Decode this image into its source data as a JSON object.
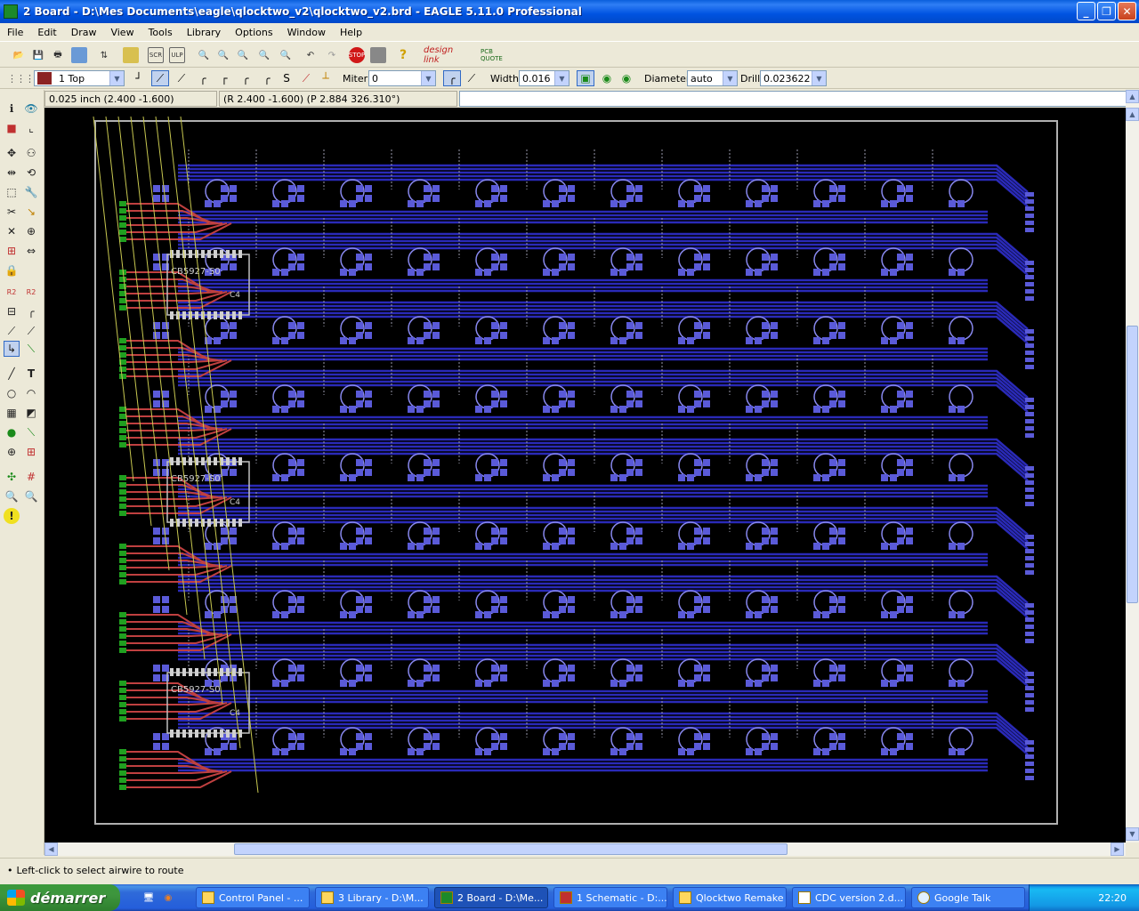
{
  "window": {
    "title": "2 Board - D:\\Mes Documents\\eagle\\qlocktwo_v2\\qlocktwo_v2.brd - EAGLE 5.11.0 Professional",
    "buttons": [
      "minimize-icon",
      "maximize-icon",
      "close-icon"
    ]
  },
  "menu": [
    "File",
    "Edit",
    "Draw",
    "View",
    "Tools",
    "Library",
    "Options",
    "Window",
    "Help"
  ],
  "toolbar1": {
    "icons": [
      "open-icon",
      "save-icon",
      "print-icon",
      "cam-icon",
      "board-icon",
      "library-icon",
      "script-icon",
      "ulp-icon",
      "zoom-fit-icon",
      "zoom-in-icon",
      "zoom-out-icon",
      "zoom-redraw-icon",
      "zoom-select-icon",
      "undo-icon",
      "redo-icon",
      "stop-icon",
      "go-icon",
      "help-icon",
      "design-link-icon",
      "pcb-quote-icon"
    ],
    "stop_label": "STOP",
    "design_link_label": "design link",
    "pcb_quote_label": "PCB QUOTE"
  },
  "toolbar2": {
    "layer_value": "1 Top",
    "layer_color": "#8b2323",
    "miter_label": "Miter:",
    "miter_value": "0",
    "width_label": "Width:",
    "width_value": "0.016",
    "diameter_label": "Diameter:",
    "diameter_value": "auto",
    "drill_label": "Drill:",
    "drill_value": "0.023622"
  },
  "coords": {
    "grid_position": "0.025 inch (2.400 -1.600)",
    "relative_polar": "(R 2.400 -1.600) (P 2.884 326.310°)",
    "command_value": ""
  },
  "canvas": {
    "background": "#000000",
    "trace_color": "#2a2ab8",
    "pad_color": "#5a5ad8",
    "top_trace_color": "#c04040",
    "outline_color": "#b0b0b0",
    "ic_label_1": "CB5927-S0",
    "ic_label_2": "CB5927-S0",
    "ic_label_3": "CB5927-S0",
    "ic_ref_1": "C4",
    "ic_ref_2": "C4",
    "ic_ref_3": "C4"
  },
  "status": {
    "message": "Left-click to select airwire to route"
  },
  "taskbar": {
    "start_label": "démarrer",
    "tasks": [
      "Control Panel - ...",
      "3 Library - D:\\M...",
      "2 Board - D:\\Me...",
      "1 Schematic - D:...",
      "Qlocktwo Remake",
      "CDC version 2.d...",
      "Google Talk"
    ],
    "clock": "22:20"
  }
}
